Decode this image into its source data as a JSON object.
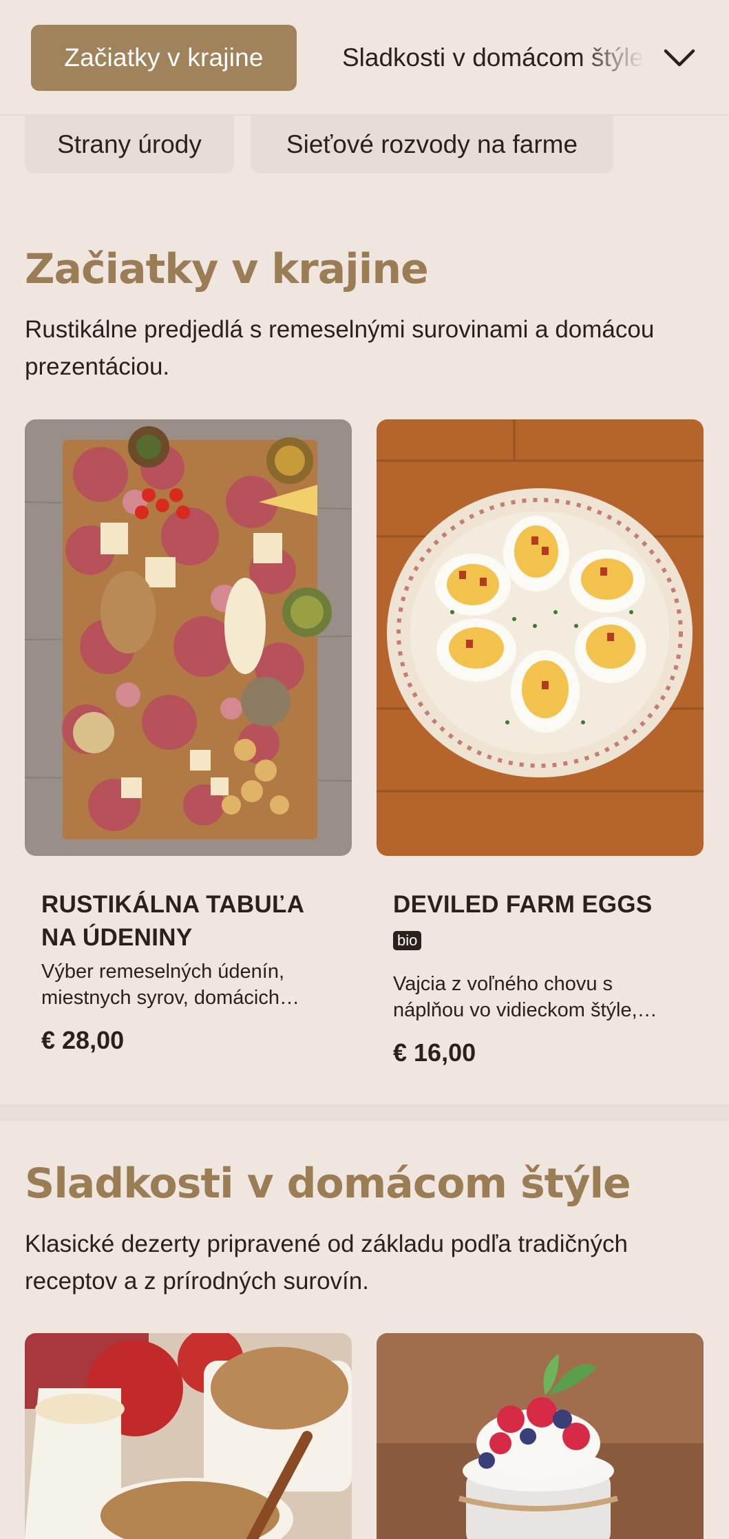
{
  "nav": {
    "active_category": "Začiatky v krajine",
    "next_category": "Sladkosti v domácom štýle",
    "pills": [
      "Strany úrody",
      "Sieťové rozvody na farme"
    ]
  },
  "sections": [
    {
      "title": "Začiatky v krajine",
      "description": "Rustikálne predjedlá s remeselnými surovinami a domácou prezentáciou.",
      "items": [
        {
          "name": "RUSTIKÁLNA TABUĽA NA ÚDENINY",
          "description": "Výber remeselných údenín, miestnych syrov, domácich…",
          "price": "€ 28,00",
          "badge": ""
        },
        {
          "name": "DEVILED FARM EGGS",
          "badge": "bio",
          "description": "Vajcia z voľného chovu s náplňou vo vidieckom štýle,…",
          "price": "€ 16,00"
        }
      ]
    },
    {
      "title": "Sladkosti v domácom štýle",
      "description": "Klasické dezerty pripravené od základu podľa tradičných receptov a z prírodných surovín."
    }
  ],
  "colors": {
    "background": "#efe6df",
    "accent": "#a0835b",
    "heading": "#9a7c55",
    "text": "#2a211b"
  },
  "icons": [
    "chevron-down-icon"
  ]
}
